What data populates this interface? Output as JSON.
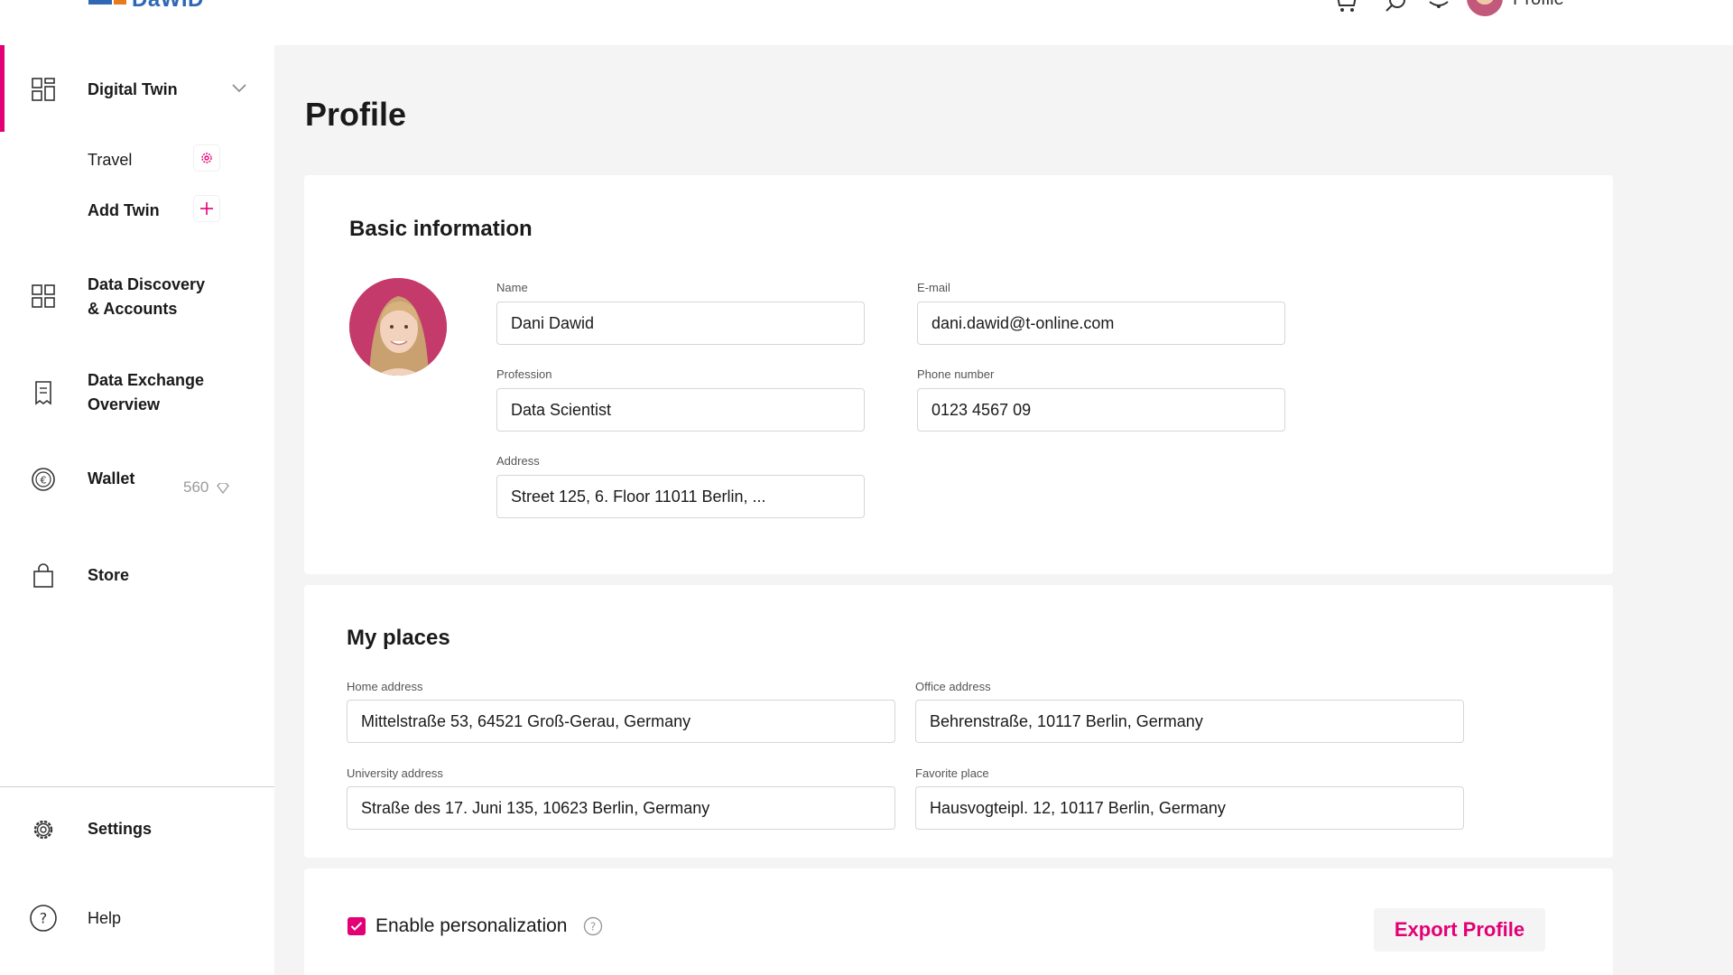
{
  "brand": {
    "name": "DaWID",
    "accent": "#e20074"
  },
  "header": {
    "profile_label": "Profile"
  },
  "sidebar": {
    "digital_twin": "Digital Twin",
    "travel": "Travel",
    "add_twin": "Add Twin",
    "data_discovery_line1": "Data Discovery",
    "data_discovery_line2": "& Accounts",
    "data_exchange_line1": "Data Exchange",
    "data_exchange_line2": "Overview",
    "wallet": "Wallet",
    "wallet_amount": "560",
    "store": "Store",
    "settings": "Settings",
    "help": "Help"
  },
  "page": {
    "title": "Profile"
  },
  "basic_info": {
    "title": "Basic information",
    "name_label": "Name",
    "name_value": "Dani Dawid",
    "email_label": "E-mail",
    "email_value": "dani.dawid@t-online.com",
    "profession_label": "Profession",
    "profession_value": "Data Scientist",
    "phone_label": "Phone number",
    "phone_value": "0123 4567 09",
    "address_label": "Address",
    "address_value": "Street 125, 6. Floor 11011 Berlin, ..."
  },
  "my_places": {
    "title": "My places",
    "home_label": "Home address",
    "home_value": "Mittelstraße 53, 64521 Groß-Gerau, Germany",
    "office_label": "Office address",
    "office_value": "Behrenstraße, 10117 Berlin, Germany",
    "university_label": "University address",
    "university_value": "Straße des 17. Juni 135, 10623 Berlin, Germany",
    "favorite_label": "Favorite place",
    "favorite_value": "Hausvogteipl. 12, 10117 Berlin, Germany"
  },
  "footer": {
    "personalization_label": "Enable personalization",
    "personalization_checked": true,
    "export_label": "Export Profile"
  },
  "icons": [
    "grid-icon",
    "chevron-down-icon",
    "gear-icon",
    "plus-icon",
    "receipt-icon",
    "euro-coin-icon",
    "diamond-icon",
    "shopping-bag-icon",
    "settings-gear-icon",
    "help-icon",
    "cart-icon",
    "search-icon",
    "bell-icon",
    "question-icon",
    "check-icon"
  ]
}
